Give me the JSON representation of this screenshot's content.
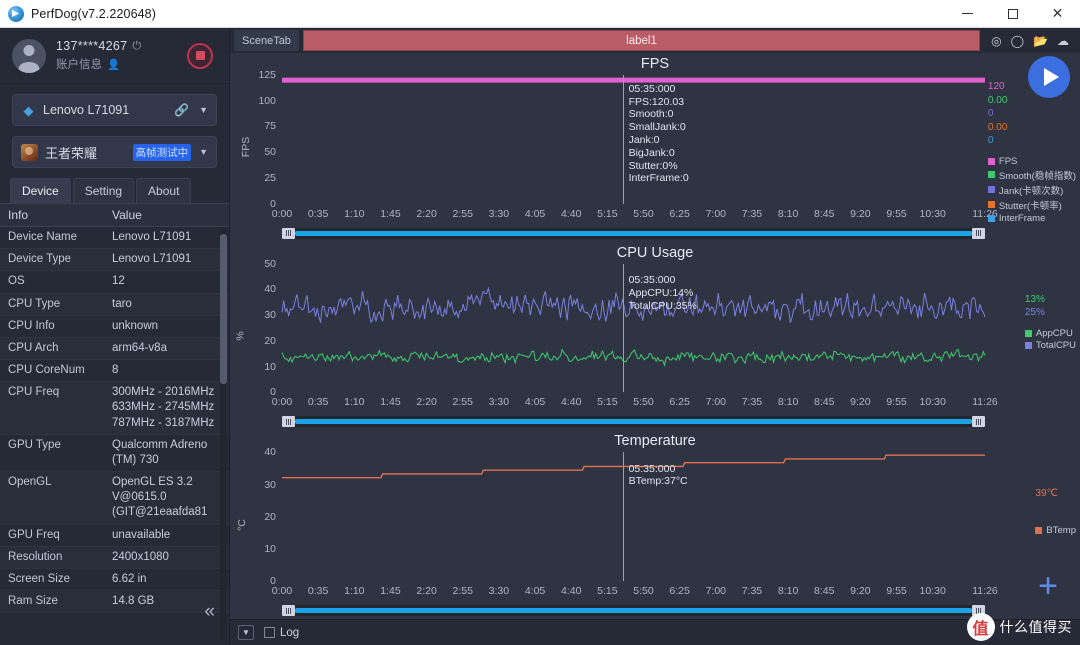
{
  "window": {
    "title": "PerfDog(v7.2.220648)",
    "app_icon": "perfdog-logo-icon",
    "minimize": "–",
    "maximize": "□",
    "close": "✕"
  },
  "sidebar": {
    "account": {
      "avatar": "user-avatar-icon",
      "phone": "137****4267",
      "power_icon": "⏻",
      "sub_label": "账户信息",
      "person_icon": "👤",
      "record_button": "stop-record-button"
    },
    "device_selector": {
      "icon": "android-icon",
      "label": "Lenovo L71091",
      "link_icon": "link-icon",
      "caret": "▼"
    },
    "app_selector": {
      "icon": "game-app-icon",
      "label": "王者荣耀",
      "badge": "高帧测试中",
      "caret": "▼"
    },
    "tabs": [
      {
        "label": "Device",
        "active": true
      },
      {
        "label": "Setting",
        "active": false
      },
      {
        "label": "About",
        "active": false
      }
    ],
    "table": {
      "columns": [
        "Info",
        "Value"
      ],
      "rows": [
        {
          "info": "Device Name",
          "value": "Lenovo L71091"
        },
        {
          "info": "Device Type",
          "value": "Lenovo L71091"
        },
        {
          "info": "OS",
          "value": "12"
        },
        {
          "info": "CPU Type",
          "value": "taro"
        },
        {
          "info": "CPU Info",
          "value": "unknown"
        },
        {
          "info": "CPU Arch",
          "value": "arm64-v8a"
        },
        {
          "info": "CPU CoreNum",
          "value": "8"
        },
        {
          "info": "CPU Freq",
          "value": "300MHz - 2016MHz\n633MHz - 2745MHz\n787MHz - 3187MHz"
        },
        {
          "info": "GPU Type",
          "value": "Qualcomm Adreno (TM) 730"
        },
        {
          "info": "OpenGL",
          "value": "OpenGL ES 3.2 V@0615.0 (GIT@21eaafda81"
        },
        {
          "info": "GPU Freq",
          "value": "unavailable"
        },
        {
          "info": "Resolution",
          "value": "2400x1080"
        },
        {
          "info": "Screen Size",
          "value": "6.62 in"
        },
        {
          "info": "Ram Size",
          "value": "14.8 GB"
        }
      ]
    },
    "collapse_icon": "«"
  },
  "scenebar": {
    "scene_tab_label": "SceneTab",
    "banner_label": "label1",
    "icons": [
      "location-pin-icon",
      "pin-icon",
      "folder-icon",
      "cloud-icon"
    ]
  },
  "statusbar": {
    "dropdown_icon": "▼",
    "log_label": "Log",
    "log_checked": false
  },
  "controls": {
    "play_button": "play-button",
    "add_button": "+",
    "watermark_mark": "值",
    "watermark_text": "什么值得买"
  },
  "colors": {
    "fps": "#e15fd0",
    "smooth": "#3ecb6e",
    "jank": "#6f72d8",
    "stutter": "#e8712c",
    "interframe": "#3f9fe0",
    "appcpu": "#3ecb6e",
    "totalcpu": "#7b7fe0",
    "btemp": "#e07050",
    "banner": "#b95c66",
    "accent": "#1ba3e8"
  },
  "chart_data": [
    {
      "type": "line",
      "title": "FPS",
      "ylabel": "FPS",
      "xlabel": "",
      "ylim": [
        0,
        125
      ],
      "yticks": [
        0,
        25,
        50,
        75,
        100,
        125
      ],
      "xticks": [
        "0:00",
        "0:35",
        "1:10",
        "1:45",
        "2:20",
        "2:55",
        "3:30",
        "4:05",
        "4:40",
        "5:15",
        "5:50",
        "6:25",
        "7:00",
        "7:35",
        "8:10",
        "8:45",
        "9:20",
        "9:55",
        "10:30",
        "11:26"
      ],
      "grid": false,
      "cursor_time": "05:35:000",
      "tooltip": [
        "05:35:000",
        "FPS:120.03",
        "Smooth:0",
        "SmallJank:0",
        "Jank:0",
        "BigJank:0",
        "Stutter:0%",
        "InterFrame:0"
      ],
      "legend_position": "right",
      "legend_values": [
        {
          "value": "120",
          "color": "#e15fd0"
        },
        {
          "value": "0.00",
          "color": "#3ecb6e"
        },
        {
          "value": "0",
          "color": "#6f72d8"
        },
        {
          "value": "0.00",
          "color": "#e8712c"
        },
        {
          "value": "0",
          "color": "#3f9fe0"
        }
      ],
      "series": [
        {
          "name": "FPS",
          "color": "#e15fd0",
          "value": 120.03
        },
        {
          "name": "Smooth(稳帧指数)",
          "color": "#3ecb6e",
          "value": 0
        },
        {
          "name": "Jank(卡顿次数)",
          "color": "#6f72d8",
          "value": 0
        },
        {
          "name": "Stutter(卡顿率)",
          "color": "#e8712c",
          "value": 0
        },
        {
          "name": "InterFrame",
          "color": "#3f9fe0",
          "value": 0
        }
      ]
    },
    {
      "type": "line",
      "title": "CPU Usage",
      "ylabel": "%",
      "xlabel": "",
      "ylim": [
        0,
        50
      ],
      "yticks": [
        0,
        10,
        20,
        30,
        40,
        50
      ],
      "xticks": [
        "0:00",
        "0:35",
        "1:10",
        "1:45",
        "2:20",
        "2:55",
        "3:30",
        "4:05",
        "4:40",
        "5:15",
        "5:50",
        "6:25",
        "7:00",
        "7:35",
        "8:10",
        "8:45",
        "9:20",
        "9:55",
        "10:30",
        "11:26"
      ],
      "grid": false,
      "cursor_time": "05:35:000",
      "tooltip": [
        "05:35:000",
        "AppCPU:14%",
        "TotalCPU:35%"
      ],
      "legend_position": "right",
      "legend_values": [
        {
          "value": "13%",
          "color": "#3ecb6e"
        },
        {
          "value": "25%",
          "color": "#7b7fe0"
        }
      ],
      "series": [
        {
          "name": "AppCPU",
          "color": "#3ecb6e",
          "value": 14,
          "mean": 13
        },
        {
          "name": "TotalCPU",
          "color": "#7b7fe0",
          "value": 35,
          "mean": 25
        }
      ]
    },
    {
      "type": "line",
      "title": "Temperature",
      "ylabel": "°C",
      "xlabel": "",
      "ylim": [
        0,
        40
      ],
      "yticks": [
        0,
        10,
        20,
        30,
        40
      ],
      "xticks": [
        "0:00",
        "0:35",
        "1:10",
        "1:45",
        "2:20",
        "2:55",
        "3:30",
        "4:05",
        "4:40",
        "5:15",
        "5:50",
        "6:25",
        "7:00",
        "7:35",
        "8:10",
        "8:45",
        "9:20",
        "9:55",
        "10:30",
        "11:26"
      ],
      "grid": false,
      "cursor_time": "05:35:000",
      "tooltip": [
        "05:35:000",
        "BTemp:37°C"
      ],
      "legend_position": "right",
      "legend_values": [
        {
          "value": "39℃",
          "color": "#e07050"
        }
      ],
      "series": [
        {
          "name": "BTemp",
          "color": "#e07050",
          "value": 37,
          "max": 39
        }
      ]
    }
  ]
}
